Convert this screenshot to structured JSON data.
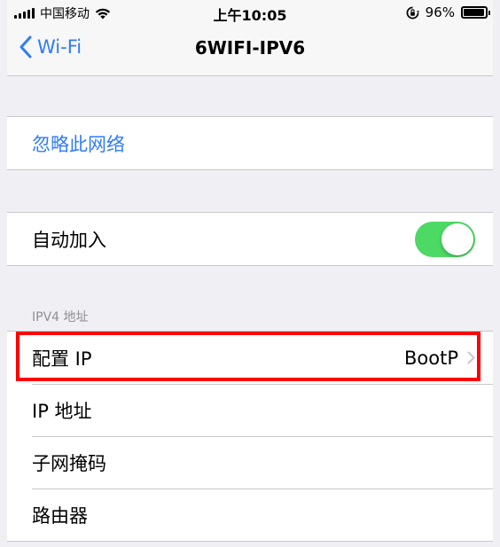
{
  "status_bar": {
    "carrier": "中国移动",
    "time": "上午10:05",
    "battery_percent": "96%",
    "battery_level": 0.96
  },
  "nav": {
    "back_label": "Wi-Fi",
    "title": "6WIFI-IPV6"
  },
  "forget_section": {
    "forget_label": "忽略此网络"
  },
  "autojoin_section": {
    "label": "自动加入",
    "enabled": true
  },
  "ipv4_section": {
    "header": "IPV4 地址",
    "rows": [
      {
        "label": "配置 IP",
        "value": "BootP"
      },
      {
        "label": "IP 地址"
      },
      {
        "label": "子网掩码"
      },
      {
        "label": "路由器"
      }
    ]
  },
  "colors": {
    "accent": "#2f7cf6",
    "toggle_on": "#4cd964",
    "highlight": "#ff0000"
  },
  "icons": {
    "signal": "cellular-signal-icon",
    "wifi": "wifi-icon",
    "orientation_lock": "orientation-lock-icon",
    "battery": "battery-icon",
    "back": "chevron-left-icon",
    "disclosure": "chevron-right-icon"
  }
}
